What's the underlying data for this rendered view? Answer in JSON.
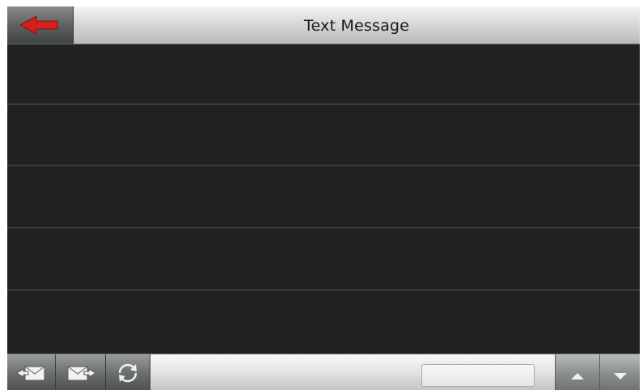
{
  "header": {
    "title": "Text Message",
    "back_icon": "back-arrow-icon"
  },
  "message_list": {
    "rows": [
      "",
      "",
      "",
      "",
      ""
    ]
  },
  "toolbar": {
    "inbox_icon": "inbox-icon",
    "outbox_icon": "outbox-icon",
    "refresh_icon": "refresh-icon",
    "page_value": "",
    "scroll_up_icon": "arrow-up-icon",
    "scroll_down_icon": "arrow-down-icon"
  },
  "colors": {
    "background": "#1f2220",
    "row_divider": "#3a3e3b",
    "back_arrow": "#d21f1f"
  }
}
